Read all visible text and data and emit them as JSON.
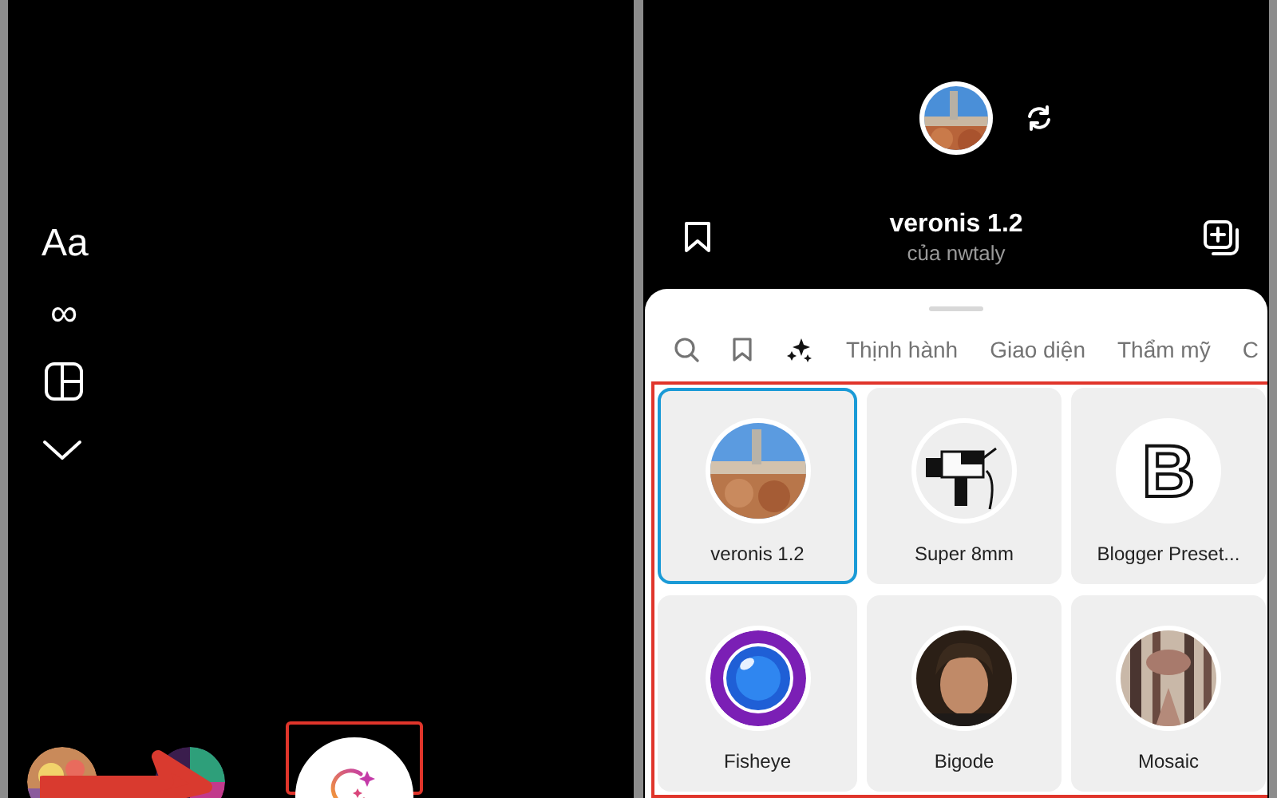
{
  "left_screen": {
    "tools": [
      {
        "kind": "text",
        "label": "Aa"
      },
      {
        "kind": "text",
        "label": "∞"
      },
      {
        "kind": "layout"
      },
      {
        "kind": "chevron"
      }
    ]
  },
  "right_screen": {
    "effect_title": "veronis 1.2",
    "effect_author": "của nwtaly",
    "tabs": [
      {
        "kind": "search",
        "selected": false
      },
      {
        "kind": "bookmark",
        "selected": false
      },
      {
        "kind": "sparkles",
        "selected": true
      },
      {
        "kind": "text",
        "label": "Thịnh hành",
        "selected": false
      },
      {
        "kind": "text",
        "label": "Giao diện",
        "selected": false
      },
      {
        "kind": "text",
        "label": "Thẩm mỹ",
        "selected": false
      },
      {
        "kind": "text",
        "label": "C",
        "selected": false
      }
    ],
    "effects": [
      {
        "name": "veronis 1.2",
        "kind": "picture",
        "selected": true
      },
      {
        "name": "Super 8mm",
        "kind": "camera",
        "selected": false
      },
      {
        "name": "Blogger Preset...",
        "kind": "logo",
        "logo_text": "B",
        "selected": false
      },
      {
        "name": "Fisheye",
        "kind": "lens",
        "selected": false
      },
      {
        "name": "Bigode",
        "kind": "picture",
        "selected": false
      },
      {
        "name": "Mosaic",
        "kind": "picture",
        "selected": false
      }
    ]
  }
}
